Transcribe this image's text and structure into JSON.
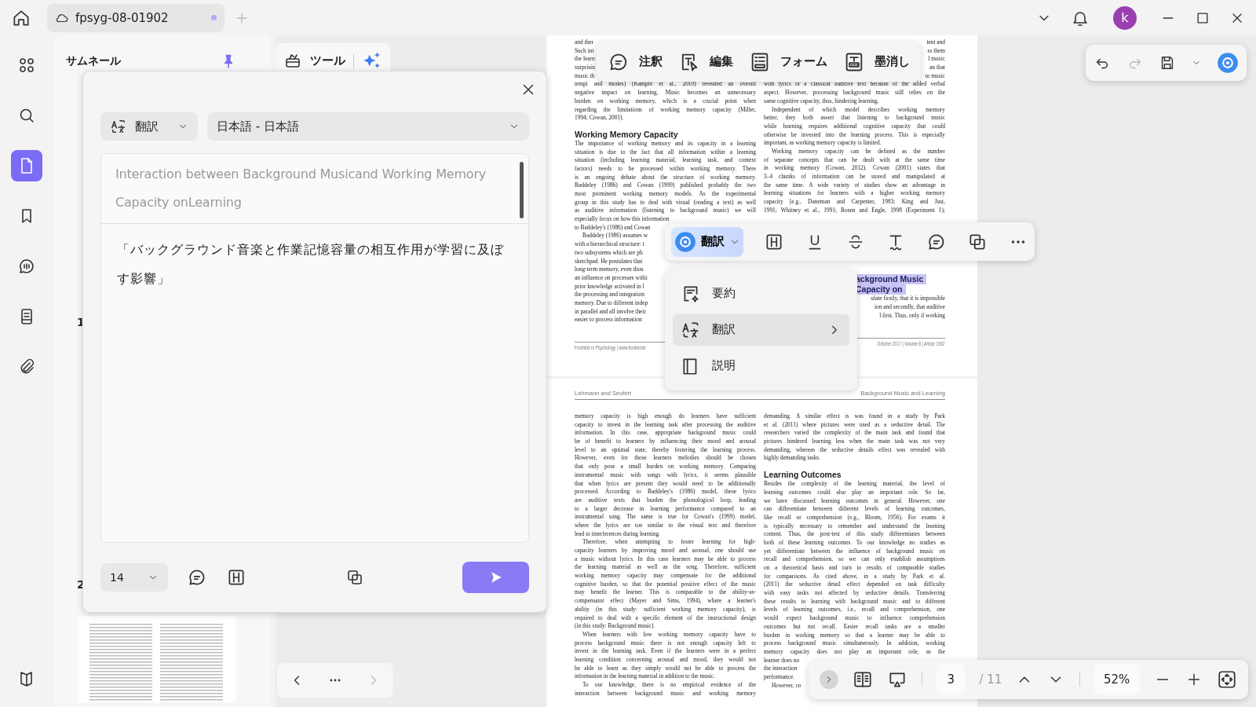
{
  "topbar": {
    "tab": {
      "title": "fpsyg-08-01902",
      "unsaved": true
    },
    "avatar": "k"
  },
  "rail": [
    {
      "selected": false
    },
    {
      "selected": false
    },
    {
      "selected": true
    },
    {
      "selected": false
    },
    {
      "selected": false
    },
    {
      "selected": false
    },
    {
      "selected": false
    }
  ],
  "thumbnails": {
    "title": "サムネール",
    "pinned": true,
    "page_numbers": [
      "1",
      "2"
    ]
  },
  "tools_tab": {
    "label": "ツール"
  },
  "translate_dialog": {
    "mode": "翻訳",
    "language": "日本語 - 日本語",
    "source": "Interaction between Background Musicand Working Memory Capacity onLearning",
    "result": "「バックグラウンド音楽と作業記憶容量の相互作用が学習に及ぼす影響」",
    "font_size": "14"
  },
  "annotation_toolbar": [
    {
      "label": "注釈"
    },
    {
      "label": "編集"
    },
    {
      "label": "フォーム"
    },
    {
      "label": "墨消し"
    }
  ],
  "history": {
    "undo_enabled": true,
    "redo_enabled": false
  },
  "selection_toolbar": {
    "ai_label": "翻訳"
  },
  "context_menu": [
    {
      "label": "要約",
      "selected": false,
      "submenu": false
    },
    {
      "label": "翻訳",
      "selected": true,
      "submenu": true
    },
    {
      "label": "説明",
      "selected": false,
      "submenu": false
    }
  ],
  "bottom_toolbar": {
    "page": "3",
    "total": "/ 11",
    "zoom": "52%"
  },
  "document": {
    "pages": [
      {
        "columns": [
          [
            {
              "kind": "para",
              "indent": false,
              "lines": [
                {
                  "text": "and ther",
                  "kind": "plain"
                },
                {
                  "text": "Such int",
                  "kind": "plain"
                },
                {
                  "text": "the learn",
                  "kind": "plain"
                },
                {
                  "text": "surprisin",
                  "kind": "plain"
                },
                {
                  "text": "music th",
                  "kind": "plain"
                },
                {
                  "text": "tempi and modes) (Kämpfe et al., 2010) revealed an overall",
                  "kind": "justified"
                },
                {
                  "text": "negative impact on learning. Music becomes an unnecessary",
                  "kind": "justified"
                },
                {
                  "text": "burden on working memory, which is a crucial point when",
                  "kind": "justified"
                },
                {
                  "text": "regarding the limitations of working memory capacity (Miller,",
                  "kind": "justified"
                },
                {
                  "text": "1994; Cowan, 2001).",
                  "kind": "plain"
                }
              ]
            },
            {
              "kind": "heading",
              "indent": false,
              "lines": [
                {
                  "text": "Working Memory Capacity",
                  "kind": "plain"
                }
              ]
            },
            {
              "kind": "para",
              "indent": false,
              "lines": [
                {
                  "text": "The importance of working memory and its capacity in a learning",
                  "kind": "justified"
                },
                {
                  "text": "situation is due to the fact that all information within a learning",
                  "kind": "justified"
                },
                {
                  "text": "situation (including learning material, learning task, and context",
                  "kind": "justified"
                },
                {
                  "text": "factors) needs to be processed within working memory. There",
                  "kind": "justified"
                },
                {
                  "text": "is an ongoing debate about the structure of working memory.",
                  "kind": "justified"
                },
                {
                  "text": "Baddeley (1986) and Cowan (1999) published probably the two",
                  "kind": "justified"
                },
                {
                  "text": "most prominent working memory models. As the experimental",
                  "kind": "justified"
                },
                {
                  "text": "group in this study has to deal with visual (reading a text) as well",
                  "kind": "justified"
                },
                {
                  "text": "as auditive information (listening to background music) we will",
                  "kind": "justified"
                },
                {
                  "text": "especially focus on how this information",
                  "kind": "plain"
                },
                {
                  "text": "to Baddeley's (1986) and Cowan",
                  "kind": "plain"
                }
              ]
            },
            {
              "kind": "para",
              "indent": true,
              "lines": [
                {
                  "text": "Baddeley (1986) assumes w",
                  "kind": "plain"
                },
                {
                  "text": "with a hierarchical structure: t",
                  "kind": "plain"
                },
                {
                  "text": "two subsystems which are ph",
                  "kind": "plain"
                },
                {
                  "text": "sketchpad. He postulates that",
                  "kind": "plain"
                },
                {
                  "text": "long-term memory, even thou",
                  "kind": "plain"
                },
                {
                  "text": "an influence on processes withi",
                  "kind": "plain"
                },
                {
                  "text": "prior knowledge activated in l",
                  "kind": "plain"
                },
                {
                  "text": "the processing and integration",
                  "kind": "plain"
                },
                {
                  "text": "memory. Due to different indep",
                  "kind": "plain"
                },
                {
                  "text": "in parallel and all involve their",
                  "kind": "plain"
                },
                {
                  "text": "easier to process information",
                  "kind": "plain"
                }
              ]
            },
            {
              "kind": "footer",
              "indent": false,
              "lines": [
                {
                  "text": "Frontiers in Psychology | www.frontiersin",
                  "kind": "plain"
                }
              ]
            }
          ],
          [
            {
              "kind": "para",
              "indent": false,
              "lines": [
                {
                  "text": "tent and",
                  "kind": "right"
                },
                {
                  "text": "ss them",
                  "kind": "right"
                },
                {
                  "text": "l music",
                  "kind": "right"
                },
                {
                  "text": "an that",
                  "kind": "right"
                },
                {
                  "text": "to music",
                  "kind": "right"
                },
                {
                  "text": "with lyrics or a classical auditive text because of the added verbal",
                  "kind": "justified"
                },
                {
                  "text": "aspect. However, processing background music still relies on the",
                  "kind": "justified"
                },
                {
                  "text": "same cognitive capacity, thus, hindering learning.",
                  "kind": "plain"
                }
              ]
            },
            {
              "kind": "para",
              "indent": true,
              "lines": [
                {
                  "text": "Independent of which model describes working memory",
                  "kind": "justified"
                },
                {
                  "text": "better, they both assert that listening to background music",
                  "kind": "justified"
                },
                {
                  "text": "while learning requires additional cognitive capacity that could",
                  "kind": "justified"
                },
                {
                  "text": "otherwise be invested into the learning process. This is especially",
                  "kind": "justified"
                },
                {
                  "text": "important, as working memory capacity is limited.",
                  "kind": "plain"
                }
              ]
            },
            {
              "kind": "para",
              "indent": true,
              "lines": [
                {
                  "text": "Working memory capacity can be defined as the number",
                  "kind": "justified"
                },
                {
                  "text": "of separate concepts that can be dealt with at the same time",
                  "kind": "justified"
                },
                {
                  "text": "in working memory (Cowan, 2012). Cowan (2001) states that",
                  "kind": "justified"
                },
                {
                  "text": "3–4 chunks of information can be stored and manipulated at",
                  "kind": "justified"
                },
                {
                  "text": "the same time. A wide variety of studies show an advantage in",
                  "kind": "justified"
                },
                {
                  "text": "learning situations for learners with a higher working memory",
                  "kind": "justified"
                },
                {
                  "text": "capacity [e.g., Daneman and Carpenter, 1983; King and Just,",
                  "kind": "justified"
                },
                {
                  "text": "1991; Whitney et al., 1991; Rosen and Engle, 1998 (Experiment 1);",
                  "kind": "justified"
                }
              ]
            },
            {
              "kind": "heading",
              "highlighted": true,
              "indent": false,
              "lines": [
                {
                  "text": "ackground Music",
                  "kind": "plain"
                },
                {
                  "text": "Capacity on",
                  "kind": "plain"
                }
              ]
            },
            {
              "kind": "para",
              "indent": false,
              "lines": [
                {
                  "text": "ulate firstly, that it is impossible",
                  "kind": "right"
                },
                {
                  "text": "ion and secondly, that auditive",
                  "kind": "right"
                },
                {
                  "text": "l first. Thus, only if working",
                  "kind": "right"
                }
              ]
            },
            {
              "kind": "footer",
              "indent": false,
              "lines": [
                {
                  "text": "October 2017 | Volume 8 | Article 1902",
                  "kind": "right"
                }
              ]
            }
          ]
        ]
      },
      {
        "header": {
          "left": "Lehmann and Seufert",
          "right": "Background Music and Learning"
        },
        "columns": [
          [
            {
              "kind": "para",
              "indent": false,
              "lines": [
                {
                  "text": "memory capacity is high enough do learners have sufficient",
                  "kind": "justified"
                },
                {
                  "text": "capacity to invest in the learning task after processing the auditive",
                  "kind": "justified"
                },
                {
                  "text": "information. In this case, appropriate background music could",
                  "kind": "justified"
                },
                {
                  "text": "be of benefit to learners by influencing their mood and arousal",
                  "kind": "justified"
                },
                {
                  "text": "level to an optimal state, thereby fostering the learning process.",
                  "kind": "justified"
                },
                {
                  "text": "However, even for those learners melodies should be chosen",
                  "kind": "justified"
                },
                {
                  "text": "that only pose a small burden on working memory. Comparing",
                  "kind": "justified"
                },
                {
                  "text": "instrumental music with songs with lyrics, it seems plausible",
                  "kind": "justified"
                },
                {
                  "text": "that when lyrics are present they would need to be additionally",
                  "kind": "justified"
                },
                {
                  "text": "processed. According to Baddeley's (1986) model, these lyrics",
                  "kind": "justified"
                },
                {
                  "text": "are auditive texts that burden the phonological loop, leading",
                  "kind": "justified"
                },
                {
                  "text": "to a larger decrease in learning performance compared to an",
                  "kind": "justified"
                },
                {
                  "text": "instrumental song. The same is true for Cowan's (1999) model,",
                  "kind": "justified"
                },
                {
                  "text": "where the lyrics are too similar to the visual text and therefore",
                  "kind": "justified"
                },
                {
                  "text": "lead to interferences during learning.",
                  "kind": "plain"
                }
              ]
            },
            {
              "kind": "para",
              "indent": true,
              "lines": [
                {
                  "text": "Therefore, when attempting to foster learning for high-",
                  "kind": "justified"
                },
                {
                  "text": "capacity learners by improving mood and arousal, one should use",
                  "kind": "justified"
                },
                {
                  "text": "a music without lyrics. In this case learners may be able to process",
                  "kind": "justified"
                },
                {
                  "text": "the learning material as well as the song. Therefore, sufficient",
                  "kind": "justified"
                },
                {
                  "text": "working memory capacity may compensate for the additional",
                  "kind": "justified"
                },
                {
                  "text": "cognitive burden, so that the potential positive effect of the music",
                  "kind": "justified"
                },
                {
                  "text": "may benefit the learner. This is comparable to the ability-as-",
                  "kind": "justified"
                },
                {
                  "text": "compensator effect (Mayer and Sims, 1994), where a learner's",
                  "kind": "justified"
                },
                {
                  "text": "ability (in this study: sufficient working memory capacity), is",
                  "kind": "justified"
                },
                {
                  "text": "required to deal with a specific element of the instructional design",
                  "kind": "justified"
                },
                {
                  "text": "(in this study: Background music).",
                  "kind": "plain"
                }
              ]
            },
            {
              "kind": "para",
              "indent": true,
              "lines": [
                {
                  "text": "When learners with low working memory capacity have to",
                  "kind": "justified"
                },
                {
                  "text": "process background music there is not enough capacity left to",
                  "kind": "justified"
                },
                {
                  "text": "invest in the learning task. Even if the learners were in a perfect",
                  "kind": "justified"
                },
                {
                  "text": "learning condition concerning arousal and mood, they would not",
                  "kind": "justified"
                },
                {
                  "text": "be able to learn as they simply would not be able to process the",
                  "kind": "justified"
                },
                {
                  "text": "information in the learning material in addition to the music.",
                  "kind": "plain"
                }
              ]
            },
            {
              "kind": "para",
              "indent": true,
              "lines": [
                {
                  "text": "To our knowledge, there is no empirical evidence of the",
                  "kind": "justified"
                },
                {
                  "text": "interaction between background music and working memory",
                  "kind": "justified"
                }
              ]
            }
          ],
          [
            {
              "kind": "para",
              "indent": false,
              "lines": [
                {
                  "text": "demanding. A similar effect is was found in a study by Park",
                  "kind": "justified"
                },
                {
                  "text": "et al. (2011) where pictures were used as a seductive detail. The",
                  "kind": "justified"
                },
                {
                  "text": "researchers varied the complexity of the main task and found that",
                  "kind": "justified"
                },
                {
                  "text": "pictures hindered learning less when the main task was not very",
                  "kind": "justified"
                },
                {
                  "text": "demanding, whereas the seductive details effect was revealed with",
                  "kind": "justified"
                },
                {
                  "text": "highly demanding tasks.",
                  "kind": "plain"
                }
              ]
            },
            {
              "kind": "heading",
              "indent": false,
              "lines": [
                {
                  "text": "Learning Outcomes",
                  "kind": "plain"
                }
              ]
            },
            {
              "kind": "para",
              "indent": false,
              "lines": [
                {
                  "text": "Besides the complexity of the learning material, the level of",
                  "kind": "justified"
                },
                {
                  "text": "learning outcomes could also play an important role. So far,",
                  "kind": "justified"
                },
                {
                  "text": "we have discussed learning outcomes in general. However, one",
                  "kind": "justified"
                },
                {
                  "text": "can differentiate between different levels of learning outcomes,",
                  "kind": "justified"
                },
                {
                  "text": "like recall or comprehension (e.g., Bloom, 1956). For exams it",
                  "kind": "justified"
                },
                {
                  "text": "is typically necessary to remember and understand the learning",
                  "kind": "justified"
                },
                {
                  "text": "content. Thus, the post-test of this study differentiates between",
                  "kind": "justified"
                },
                {
                  "text": "both of these learning outcomes. To our knowledge no studies as",
                  "kind": "justified"
                },
                {
                  "text": "yet differentiate between the influence of background music on",
                  "kind": "justified"
                },
                {
                  "text": "recall and comprehension, so we can only establish assumptions",
                  "kind": "justified"
                },
                {
                  "text": "on a theoretical basis and turn to results of comparable studies",
                  "kind": "justified"
                },
                {
                  "text": "for comparisons. As cited above, in a study by Park et al.",
                  "kind": "justified"
                },
                {
                  "text": "(2011) the seductive detail effect depended on task difficulty",
                  "kind": "justified"
                },
                {
                  "text": "with easy tasks not affected by seductive details. Transferring",
                  "kind": "justified"
                },
                {
                  "text": "these results to learning with background music and to different",
                  "kind": "justified"
                },
                {
                  "text": "levels of learning outcomes, i.e., recall and comprehension, one",
                  "kind": "justified"
                },
                {
                  "text": "would expect background music to influence comprehension",
                  "kind": "justified"
                },
                {
                  "text": "outcomes but not recall. Easier recall tasks are a smaller",
                  "kind": "justified"
                },
                {
                  "text": "burden in working memory so that a learner may be able to",
                  "kind": "justified"
                },
                {
                  "text": "process background music simultaneously. In addition, working",
                  "kind": "justified"
                },
                {
                  "text": "memory capacity does not play an important role, as the",
                  "kind": "justified"
                },
                {
                  "text": "learner does no",
                  "kind": "plain"
                },
                {
                  "text": "the interaction",
                  "kind": "plain"
                },
                {
                  "text": "performance.",
                  "kind": "plain"
                }
              ]
            },
            {
              "kind": "para",
              "indent": true,
              "lines": [
                {
                  "text": "However, co",
                  "kind": "plain"
                }
              ]
            }
          ]
        ]
      }
    ]
  }
}
